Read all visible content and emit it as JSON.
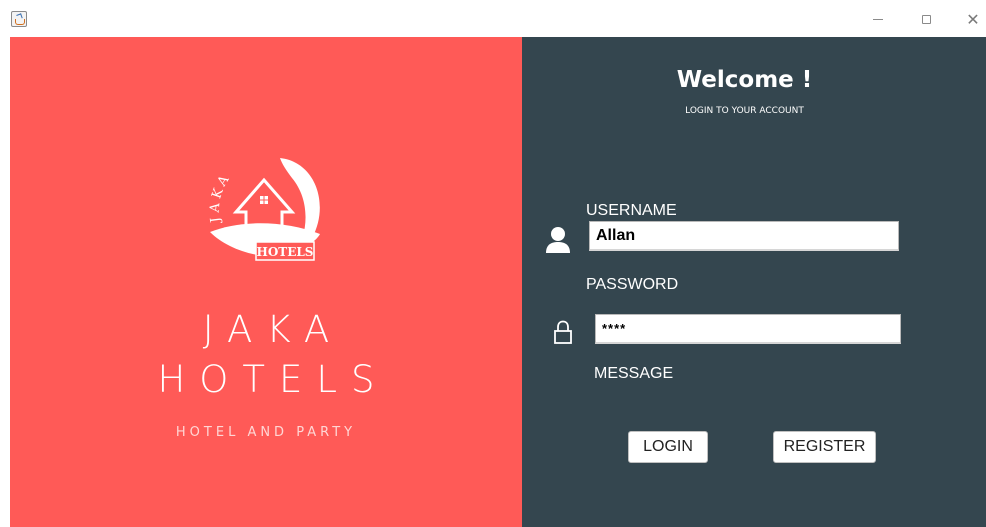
{
  "window": {
    "minimize_icon": "minimize-icon",
    "maximize_icon": "maximize-icon",
    "close_icon": "close-icon",
    "close_glyph": "✕"
  },
  "brand": {
    "logo_arc_text": "JAKA",
    "logo_ribbon_text": "HOTELS",
    "name_line1": "JAKA",
    "name_line2": "HOTELS",
    "tagline": "HOTEL AND PARTY",
    "background_color": "#ff5a57"
  },
  "login": {
    "title": "Welcome !",
    "subtitle": "LOGIN TO YOUR ACCOUNT",
    "username_label": "USERNAME",
    "username_value": "Allan",
    "password_label": "PASSWORD",
    "password_value": "****",
    "message_label": "MESSAGE",
    "login_button": "LOGIN",
    "register_button": "REGISTER",
    "background_color": "#34464f"
  }
}
